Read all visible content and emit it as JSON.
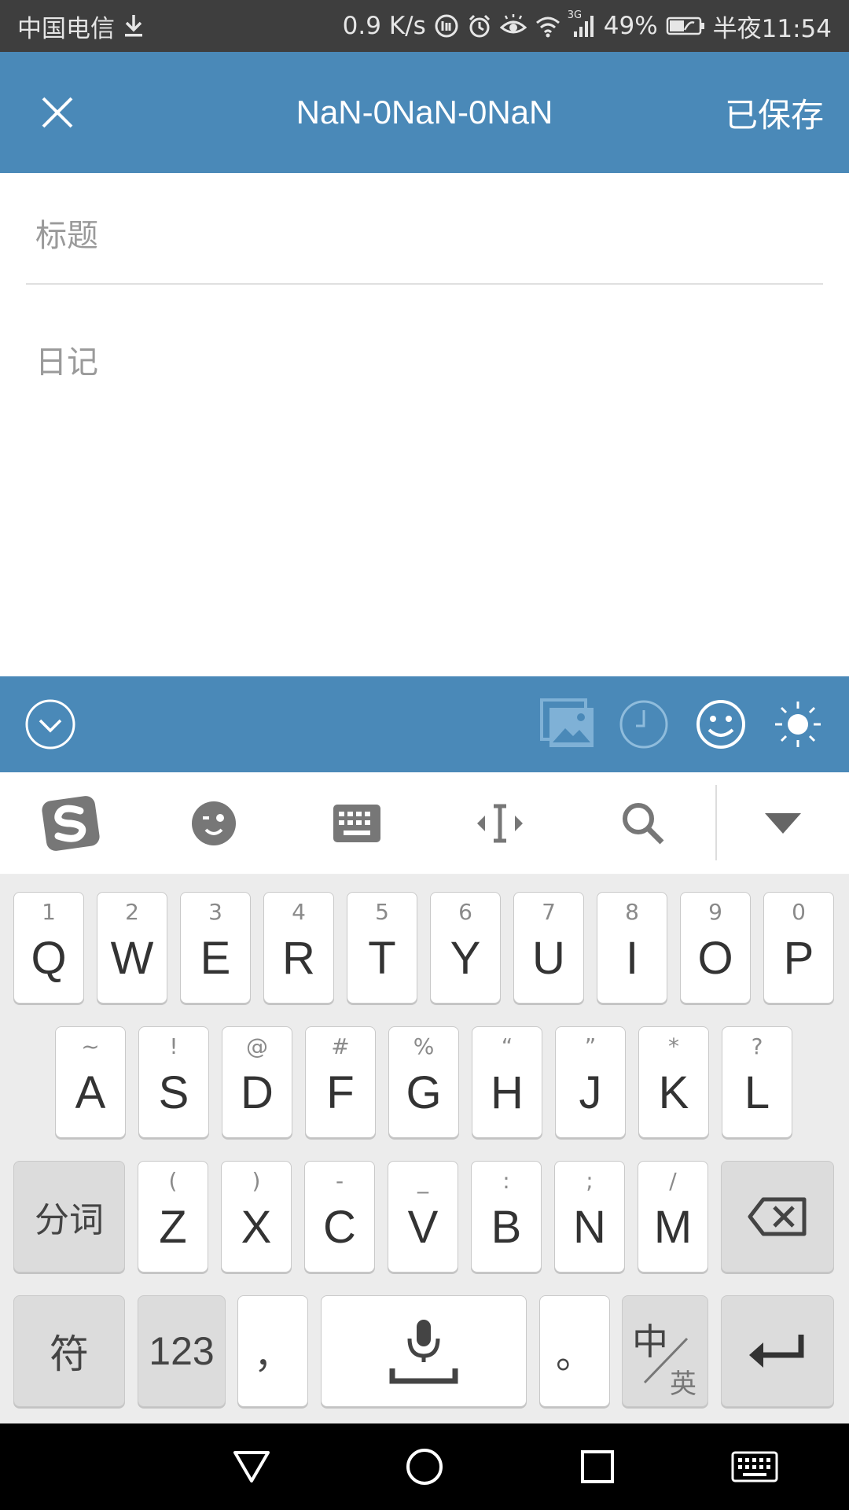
{
  "status_bar": {
    "carrier": "中国电信",
    "net_speed": "0.9 K/s",
    "network_type": "3G",
    "battery": "49%",
    "time": "半夜11:54"
  },
  "header": {
    "title": "NaN-0NaN-0NaN",
    "saved_label": "已保存"
  },
  "editor": {
    "title_placeholder": "标题",
    "diary_placeholder": "日记"
  },
  "keyboard": {
    "row1": [
      {
        "hint": "1",
        "key": "Q"
      },
      {
        "hint": "2",
        "key": "W"
      },
      {
        "hint": "3",
        "key": "E"
      },
      {
        "hint": "4",
        "key": "R"
      },
      {
        "hint": "5",
        "key": "T"
      },
      {
        "hint": "6",
        "key": "Y"
      },
      {
        "hint": "7",
        "key": "U"
      },
      {
        "hint": "8",
        "key": "I"
      },
      {
        "hint": "9",
        "key": "O"
      },
      {
        "hint": "0",
        "key": "P"
      }
    ],
    "row2": [
      {
        "hint": "~",
        "key": "A"
      },
      {
        "hint": "!",
        "key": "S"
      },
      {
        "hint": "@",
        "key": "D"
      },
      {
        "hint": "#",
        "key": "F"
      },
      {
        "hint": "%",
        "key": "G"
      },
      {
        "hint": "“",
        "key": "H"
      },
      {
        "hint": "”",
        "key": "J"
      },
      {
        "hint": "*",
        "key": "K"
      },
      {
        "hint": "?",
        "key": "L"
      }
    ],
    "row3": [
      {
        "hint": "(",
        "key": "Z"
      },
      {
        "hint": ")",
        "key": "X"
      },
      {
        "hint": "-",
        "key": "C"
      },
      {
        "hint": "_",
        "key": "V"
      },
      {
        "hint": ":",
        "key": "B"
      },
      {
        "hint": ";",
        "key": "N"
      },
      {
        "hint": "/",
        "key": "M"
      }
    ],
    "segment_label": "分词",
    "symbol_label": "符",
    "number_label": "123",
    "comma_label": "，",
    "period_label": "。",
    "lang_primary": "中",
    "lang_secondary": "英"
  },
  "colors": {
    "accent": "#4a89b8",
    "status_bar_bg": "#3e3e3e",
    "keyboard_bg": "#ececec"
  }
}
